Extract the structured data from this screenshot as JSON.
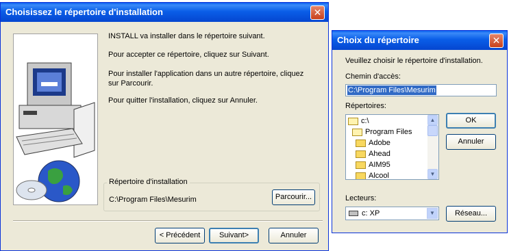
{
  "install_dialog": {
    "title": "Choisissez le répertoire d'installation",
    "close": "✕",
    "line1": "INSTALL va installer  dans le répertoire suivant.",
    "line2": "Pour accepter ce répertoire, cliquez sur Suivant.",
    "line3": "Pour installer l'application dans un autre répertoire, cliquez sur Parcourir.",
    "line4": "Pour quitter l'installation, cliquez sur Annuler.",
    "group_label": "Répertoire d'installation",
    "install_path": "C:\\Program Files\\Mesurim",
    "browse_button": "Parcourir...",
    "back_button": "< Précédent",
    "next_button": "Suivant>",
    "cancel_button": "Annuler"
  },
  "dir_dialog": {
    "title": "Choix du répertoire",
    "close": "✕",
    "instruction": "Veuillez choisir le répertoire d'installation.",
    "path_label": "Chemin d'accès:",
    "path_value": "C:\\Program Files\\Mesurim",
    "dirs_label": "Répertoires:",
    "dirs": [
      {
        "name": "c:\\",
        "icon": "open-folder-icon"
      },
      {
        "name": "Program Files",
        "icon": "open-folder-icon"
      },
      {
        "name": "Adobe",
        "icon": "folder-icon"
      },
      {
        "name": "Ahead",
        "icon": "folder-icon"
      },
      {
        "name": "AIM95",
        "icon": "folder-icon"
      },
      {
        "name": "Alcool",
        "icon": "folder-icon"
      }
    ],
    "ok_button": "OK",
    "cancel_button": "Annuler",
    "drives_label": "Lecteurs:",
    "drive_value": "c: XP",
    "network_button": "Réseau..."
  },
  "colors": {
    "titlebar": "#0a5ee8",
    "window_bg": "#ece9d8",
    "selection": "#316ac5"
  }
}
